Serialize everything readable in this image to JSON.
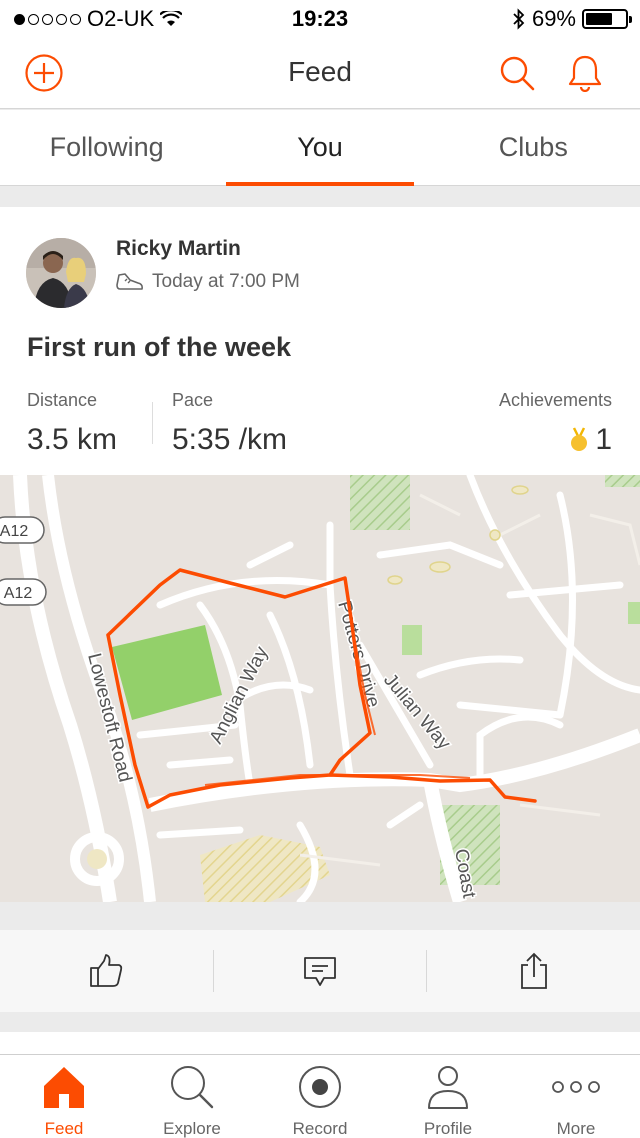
{
  "status_bar": {
    "carrier": "O2-UK",
    "time": "19:23",
    "battery": "69%",
    "battery_level": 0.69
  },
  "header": {
    "title": "Feed"
  },
  "tabs": [
    {
      "label": "Following"
    },
    {
      "label": "You"
    },
    {
      "label": "Clubs"
    }
  ],
  "activity": {
    "athlete": "Ricky Martin",
    "time": "Today at 7:00 PM",
    "title": "First run of the week",
    "stats": {
      "distance_label": "Distance",
      "distance": "3.5 km",
      "pace_label": "Pace",
      "pace": "5:35 /km",
      "achievements_label": "Achievements",
      "achievements": "1"
    },
    "map_labels": {
      "road1": "A12",
      "road2": "A12",
      "lowestoft": "Lowestoft Road",
      "anglian": "Anglian Way",
      "potters": "Potters Drive",
      "julian": "Julian Way",
      "coast": "Coast"
    }
  },
  "bottom_nav": [
    {
      "label": "Feed"
    },
    {
      "label": "Explore"
    },
    {
      "label": "Record"
    },
    {
      "label": "Profile"
    },
    {
      "label": "More"
    }
  ],
  "colors": {
    "accent": "#fc4c02"
  }
}
